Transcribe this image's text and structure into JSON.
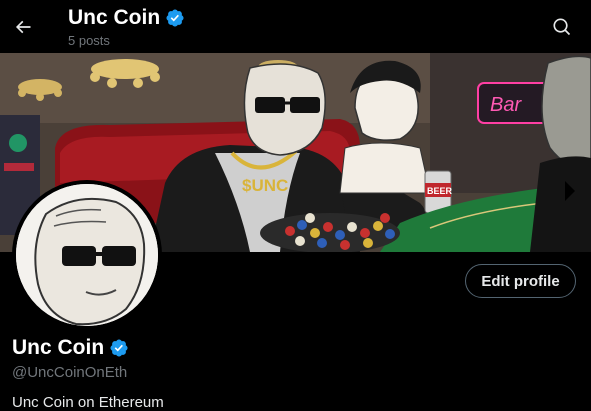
{
  "header": {
    "title": "Unc Coin",
    "subtitle": "5 posts"
  },
  "banner": {
    "banner_text": "$UNC",
    "neon_sign": "Bar",
    "can_label": "BEER"
  },
  "actions": {
    "edit_profile_label": "Edit profile"
  },
  "profile": {
    "name": "Unc Coin",
    "handle": "@UncCoinOnEth",
    "bio": "Unc Coin on Ethereum"
  },
  "colors": {
    "background": "#000000",
    "verified": "#1d9bf0",
    "muted_text": "#71767b",
    "table_green": "#1f7a3a"
  },
  "icons": {
    "back": "arrow-left-icon",
    "search": "search-icon",
    "verified": "verified-badge-icon"
  }
}
